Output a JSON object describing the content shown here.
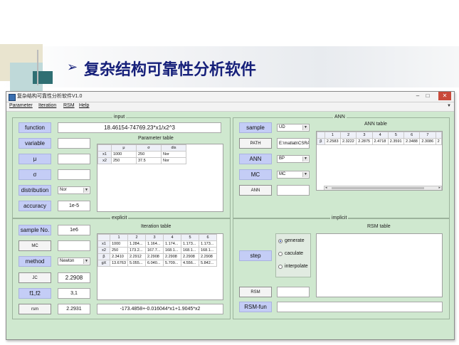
{
  "slide": {
    "title": "复杂结构可靠性分析软件"
  },
  "window": {
    "title": "复杂结构可靠性分析软件V1.0",
    "controls": {
      "minimize": "–",
      "maximize": "□",
      "close": "✕"
    }
  },
  "menu": {
    "items": [
      "Parameter",
      "Iteration",
      "RSM",
      "Help"
    ]
  },
  "input": {
    "title": "input",
    "function_label": "function",
    "function_value": "18.46154-74769.23*x1/x2^3",
    "variable_label": "variable",
    "mu_label": "μ",
    "sigma_label": "σ",
    "distribution_label": "distribution",
    "distribution_value": "Nor",
    "accuracy_label": "accuracy",
    "accuracy_value": "1e-5",
    "table": {
      "caption": "Parameter table",
      "headers": [
        "",
        "μ",
        "σ",
        "dis"
      ],
      "rows": [
        [
          "x1",
          "1000",
          "250",
          "Nor"
        ],
        [
          "x2",
          "250",
          "37.5",
          "Nor"
        ]
      ]
    }
  },
  "ann": {
    "title": "ANN",
    "sample_label": "sample",
    "sample_value": "UD",
    "path_label": "PATH",
    "path_value": "E:\\matlab\\CSRA_",
    "ann_label": "ANN",
    "ann_value": "BP",
    "mc_label": "MC",
    "mc_value": "MC",
    "ann_button": "ANN",
    "table": {
      "caption": "ANN table",
      "headers": [
        "",
        "1",
        "2",
        "3",
        "4",
        "5",
        "6",
        "7"
      ],
      "rows": [
        [
          "β",
          "2.2583",
          "2.3222",
          "2.2875",
          "2.4718",
          "2.3591",
          "2.3488",
          "2.3086",
          "2"
        ]
      ]
    }
  },
  "explicit": {
    "title": "explicit",
    "sample_no_label": "sample No.",
    "sample_no_value": "1e6",
    "mc_button": "MC",
    "method_label": "method",
    "method_value": "Newton",
    "jc_button": "JC",
    "jc_value": "2.2908",
    "f1f2_label": "f1,f2",
    "f1f2_value": "3,1",
    "rsm_button": "rsm",
    "rsm_value": "2.2931",
    "rsm_function": "-173.4858+-0.016044*x1+1.9045*x2",
    "table": {
      "caption": "Iteration table",
      "headers": [
        "",
        "1",
        "2",
        "3",
        "4",
        "5",
        "6"
      ],
      "rows": [
        [
          "x1",
          "1000",
          "1.284...",
          "1.164...",
          "1.174...",
          "1.173...",
          "1.173..."
        ],
        [
          "x2",
          "250",
          "173.2...",
          "167.7...",
          "168.1...",
          "168.1...",
          "168.1..."
        ],
        [
          "β",
          "2.3410",
          "2.2912",
          "2.2908",
          "2.2908",
          "2.2908",
          "2.2908"
        ],
        [
          "gX",
          "13.6763",
          "5.055...",
          "6.040...",
          "5.709...",
          "4.556...",
          "5.842..."
        ]
      ]
    }
  },
  "implicit": {
    "title": "implicit",
    "step_label": "step",
    "radios": [
      {
        "label": "generate",
        "selected": true
      },
      {
        "label": "caculate",
        "selected": false
      },
      {
        "label": "interpolate",
        "selected": false
      }
    ],
    "rsm_button": "RSM",
    "rsm_fun_label": "RSM-fun",
    "table_caption": "RSM table"
  },
  "colors": {
    "panel_bg": "#cfe8cf",
    "label_bg": "#c4cdf6",
    "title_text": "#16207a"
  }
}
